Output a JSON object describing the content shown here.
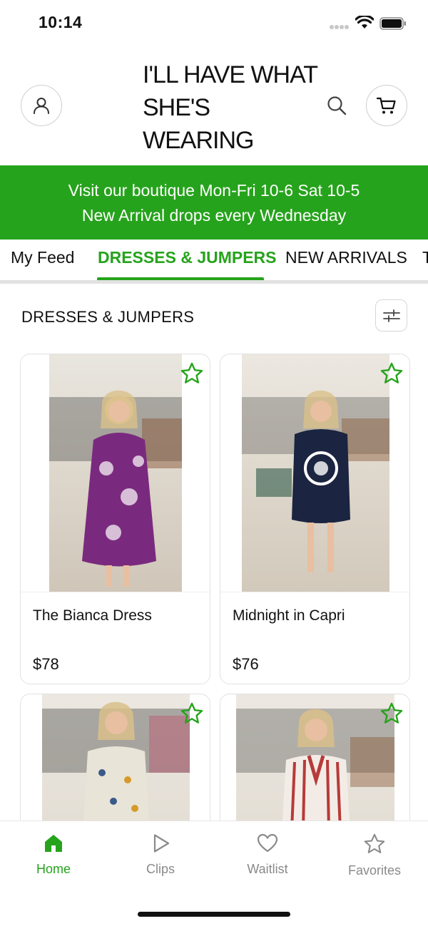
{
  "status_bar": {
    "time": "10:14"
  },
  "header": {
    "brand": "I'LL HAVE WHAT SHE'S WEARING"
  },
  "banner": {
    "line1": "Visit our boutique Mon-Fri 10-6  Sat 10-5",
    "line2": "New Arrival drops every Wednesday"
  },
  "tabs": [
    {
      "label": "My Feed",
      "active": false
    },
    {
      "label": "DRESSES & JUMPERS",
      "active": true
    },
    {
      "label": "NEW ARRIVALS",
      "active": false
    },
    {
      "label": "T",
      "active": false
    }
  ],
  "section": {
    "title": "DRESSES & JUMPERS"
  },
  "products": [
    {
      "name": "The Bianca Dress",
      "price": "$78",
      "dress_color": "#7a2a7e"
    },
    {
      "name": "Midnight in Capri",
      "price": "$76",
      "dress_color": "#1b2440"
    },
    {
      "name": "",
      "price": "",
      "dress_color": "#e9e4d8"
    },
    {
      "name": "",
      "price": "",
      "dress_color": "#b73a3a"
    }
  ],
  "bottom_nav": [
    {
      "label": "Home",
      "icon": "home-icon",
      "active": true
    },
    {
      "label": "Clips",
      "icon": "play-icon",
      "active": false
    },
    {
      "label": "Waitlist",
      "icon": "heart-icon",
      "active": false
    },
    {
      "label": "Favorites",
      "icon": "star-icon",
      "active": false
    }
  ],
  "colors": {
    "accent": "#26a31c",
    "text": "#111111",
    "muted": "#8a8a8a"
  }
}
